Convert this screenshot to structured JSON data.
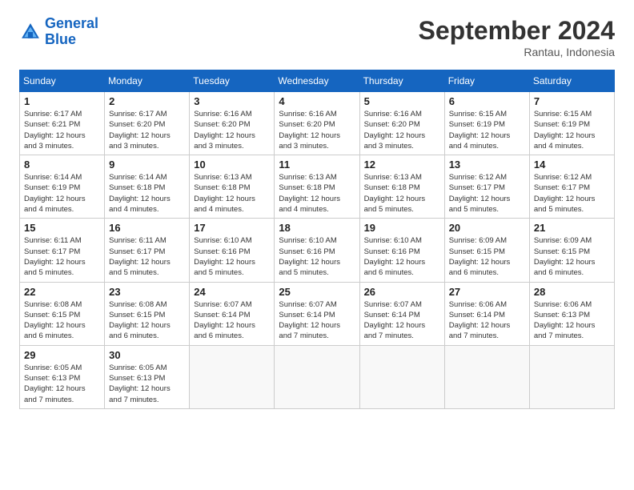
{
  "logo": {
    "line1": "General",
    "line2": "Blue"
  },
  "title": "September 2024",
  "location": "Rantau, Indonesia",
  "days_header": [
    "Sunday",
    "Monday",
    "Tuesday",
    "Wednesday",
    "Thursday",
    "Friday",
    "Saturday"
  ],
  "weeks": [
    [
      {
        "day": "1",
        "info": "Sunrise: 6:17 AM\nSunset: 6:21 PM\nDaylight: 12 hours\nand 3 minutes."
      },
      {
        "day": "2",
        "info": "Sunrise: 6:17 AM\nSunset: 6:20 PM\nDaylight: 12 hours\nand 3 minutes."
      },
      {
        "day": "3",
        "info": "Sunrise: 6:16 AM\nSunset: 6:20 PM\nDaylight: 12 hours\nand 3 minutes."
      },
      {
        "day": "4",
        "info": "Sunrise: 6:16 AM\nSunset: 6:20 PM\nDaylight: 12 hours\nand 3 minutes."
      },
      {
        "day": "5",
        "info": "Sunrise: 6:16 AM\nSunset: 6:20 PM\nDaylight: 12 hours\nand 3 minutes."
      },
      {
        "day": "6",
        "info": "Sunrise: 6:15 AM\nSunset: 6:19 PM\nDaylight: 12 hours\nand 4 minutes."
      },
      {
        "day": "7",
        "info": "Sunrise: 6:15 AM\nSunset: 6:19 PM\nDaylight: 12 hours\nand 4 minutes."
      }
    ],
    [
      {
        "day": "8",
        "info": "Sunrise: 6:14 AM\nSunset: 6:19 PM\nDaylight: 12 hours\nand 4 minutes."
      },
      {
        "day": "9",
        "info": "Sunrise: 6:14 AM\nSunset: 6:18 PM\nDaylight: 12 hours\nand 4 minutes."
      },
      {
        "day": "10",
        "info": "Sunrise: 6:13 AM\nSunset: 6:18 PM\nDaylight: 12 hours\nand 4 minutes."
      },
      {
        "day": "11",
        "info": "Sunrise: 6:13 AM\nSunset: 6:18 PM\nDaylight: 12 hours\nand 4 minutes."
      },
      {
        "day": "12",
        "info": "Sunrise: 6:13 AM\nSunset: 6:18 PM\nDaylight: 12 hours\nand 5 minutes."
      },
      {
        "day": "13",
        "info": "Sunrise: 6:12 AM\nSunset: 6:17 PM\nDaylight: 12 hours\nand 5 minutes."
      },
      {
        "day": "14",
        "info": "Sunrise: 6:12 AM\nSunset: 6:17 PM\nDaylight: 12 hours\nand 5 minutes."
      }
    ],
    [
      {
        "day": "15",
        "info": "Sunrise: 6:11 AM\nSunset: 6:17 PM\nDaylight: 12 hours\nand 5 minutes."
      },
      {
        "day": "16",
        "info": "Sunrise: 6:11 AM\nSunset: 6:17 PM\nDaylight: 12 hours\nand 5 minutes."
      },
      {
        "day": "17",
        "info": "Sunrise: 6:10 AM\nSunset: 6:16 PM\nDaylight: 12 hours\nand 5 minutes."
      },
      {
        "day": "18",
        "info": "Sunrise: 6:10 AM\nSunset: 6:16 PM\nDaylight: 12 hours\nand 5 minutes."
      },
      {
        "day": "19",
        "info": "Sunrise: 6:10 AM\nSunset: 6:16 PM\nDaylight: 12 hours\nand 6 minutes."
      },
      {
        "day": "20",
        "info": "Sunrise: 6:09 AM\nSunset: 6:15 PM\nDaylight: 12 hours\nand 6 minutes."
      },
      {
        "day": "21",
        "info": "Sunrise: 6:09 AM\nSunset: 6:15 PM\nDaylight: 12 hours\nand 6 minutes."
      }
    ],
    [
      {
        "day": "22",
        "info": "Sunrise: 6:08 AM\nSunset: 6:15 PM\nDaylight: 12 hours\nand 6 minutes."
      },
      {
        "day": "23",
        "info": "Sunrise: 6:08 AM\nSunset: 6:15 PM\nDaylight: 12 hours\nand 6 minutes."
      },
      {
        "day": "24",
        "info": "Sunrise: 6:07 AM\nSunset: 6:14 PM\nDaylight: 12 hours\nand 6 minutes."
      },
      {
        "day": "25",
        "info": "Sunrise: 6:07 AM\nSunset: 6:14 PM\nDaylight: 12 hours\nand 7 minutes."
      },
      {
        "day": "26",
        "info": "Sunrise: 6:07 AM\nSunset: 6:14 PM\nDaylight: 12 hours\nand 7 minutes."
      },
      {
        "day": "27",
        "info": "Sunrise: 6:06 AM\nSunset: 6:14 PM\nDaylight: 12 hours\nand 7 minutes."
      },
      {
        "day": "28",
        "info": "Sunrise: 6:06 AM\nSunset: 6:13 PM\nDaylight: 12 hours\nand 7 minutes."
      }
    ],
    [
      {
        "day": "29",
        "info": "Sunrise: 6:05 AM\nSunset: 6:13 PM\nDaylight: 12 hours\nand 7 minutes."
      },
      {
        "day": "30",
        "info": "Sunrise: 6:05 AM\nSunset: 6:13 PM\nDaylight: 12 hours\nand 7 minutes."
      },
      null,
      null,
      null,
      null,
      null
    ]
  ]
}
